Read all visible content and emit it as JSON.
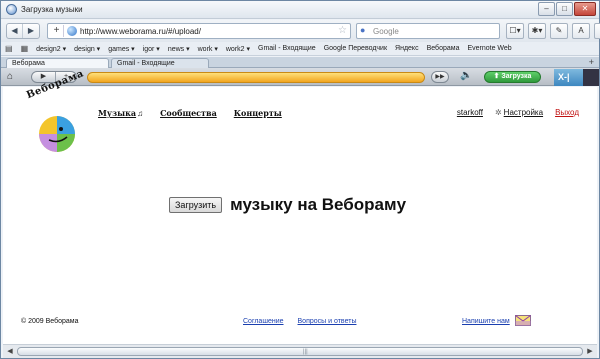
{
  "window": {
    "title": "Загрузка музыки"
  },
  "nav": {
    "back": "◀",
    "forward": "▶",
    "add": "+",
    "url": "http://www.weborama.ru/#/upload/",
    "search_placeholder": "Google",
    "tools": [
      "☐▾",
      "✱▾",
      "✎",
      "A",
      "A"
    ]
  },
  "bookmarks": [
    "design2 ▾",
    "design ▾",
    "games ▾",
    "igor ▾",
    "news ▾",
    "work ▾",
    "work2 ▾",
    "Gmail - Входящие",
    "Google Переводчик",
    "Яндекс",
    "Веборама",
    "Evernote Web"
  ],
  "tabs": [
    {
      "label": "Веборама",
      "active": true
    },
    {
      "label": "Gmail - Входящие",
      "active": false
    }
  ],
  "player": {
    "upload_label": "⬆ Загрузка",
    "badge": "X-|"
  },
  "site": {
    "logo_text": "Веборама",
    "nav": [
      "Музыка",
      "Сообщества",
      "Концерты"
    ],
    "nav_note": "♫",
    "user": "starkoff",
    "settings": "Настройка",
    "logout": "Выход",
    "upload_button": "Загрузить",
    "headline": "музыку на Веборамy",
    "copyright": "© 2009 Веборама",
    "footer_links": [
      "Соглашение",
      "Вопросы и ответы"
    ],
    "write_us": "Напишите нам"
  },
  "colors": {
    "accent_logo": [
      "#e33",
      "#f90",
      "#1a9",
      "#48c"
    ],
    "logout": "#c01010",
    "upload_pill": "#3caa45"
  }
}
